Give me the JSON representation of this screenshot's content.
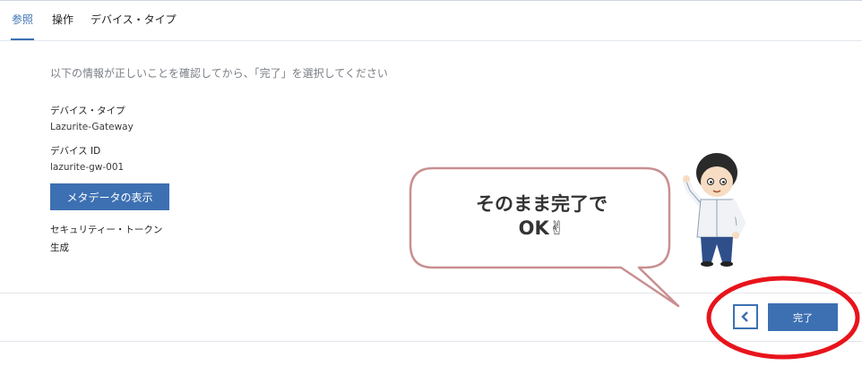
{
  "tabs": [
    {
      "label": "参照",
      "active": true
    },
    {
      "label": "操作",
      "active": false
    },
    {
      "label": "デバイス・タイプ",
      "active": false
    }
  ],
  "instruction": "以下の情報が正しいことを確認してから、「完了」を選択してください",
  "fields": {
    "device_type_label": "デバイス・タイプ",
    "device_type_value": "Lazurite-Gateway",
    "device_id_label": "デバイス ID",
    "device_id_value": "lazurite-gw-001",
    "security_token_label": "セキュリティー・トークン",
    "security_token_value": "生成"
  },
  "buttons": {
    "metadata": "メタデータの表示",
    "back_icon": "chevron-left-icon",
    "done": "完了"
  },
  "callout": {
    "line1": "そのまま完了で",
    "line2": "OK✌"
  },
  "colors": {
    "accent": "#3d70b2",
    "highlight": "#e8141c",
    "bubble_border": "#c98f90"
  }
}
